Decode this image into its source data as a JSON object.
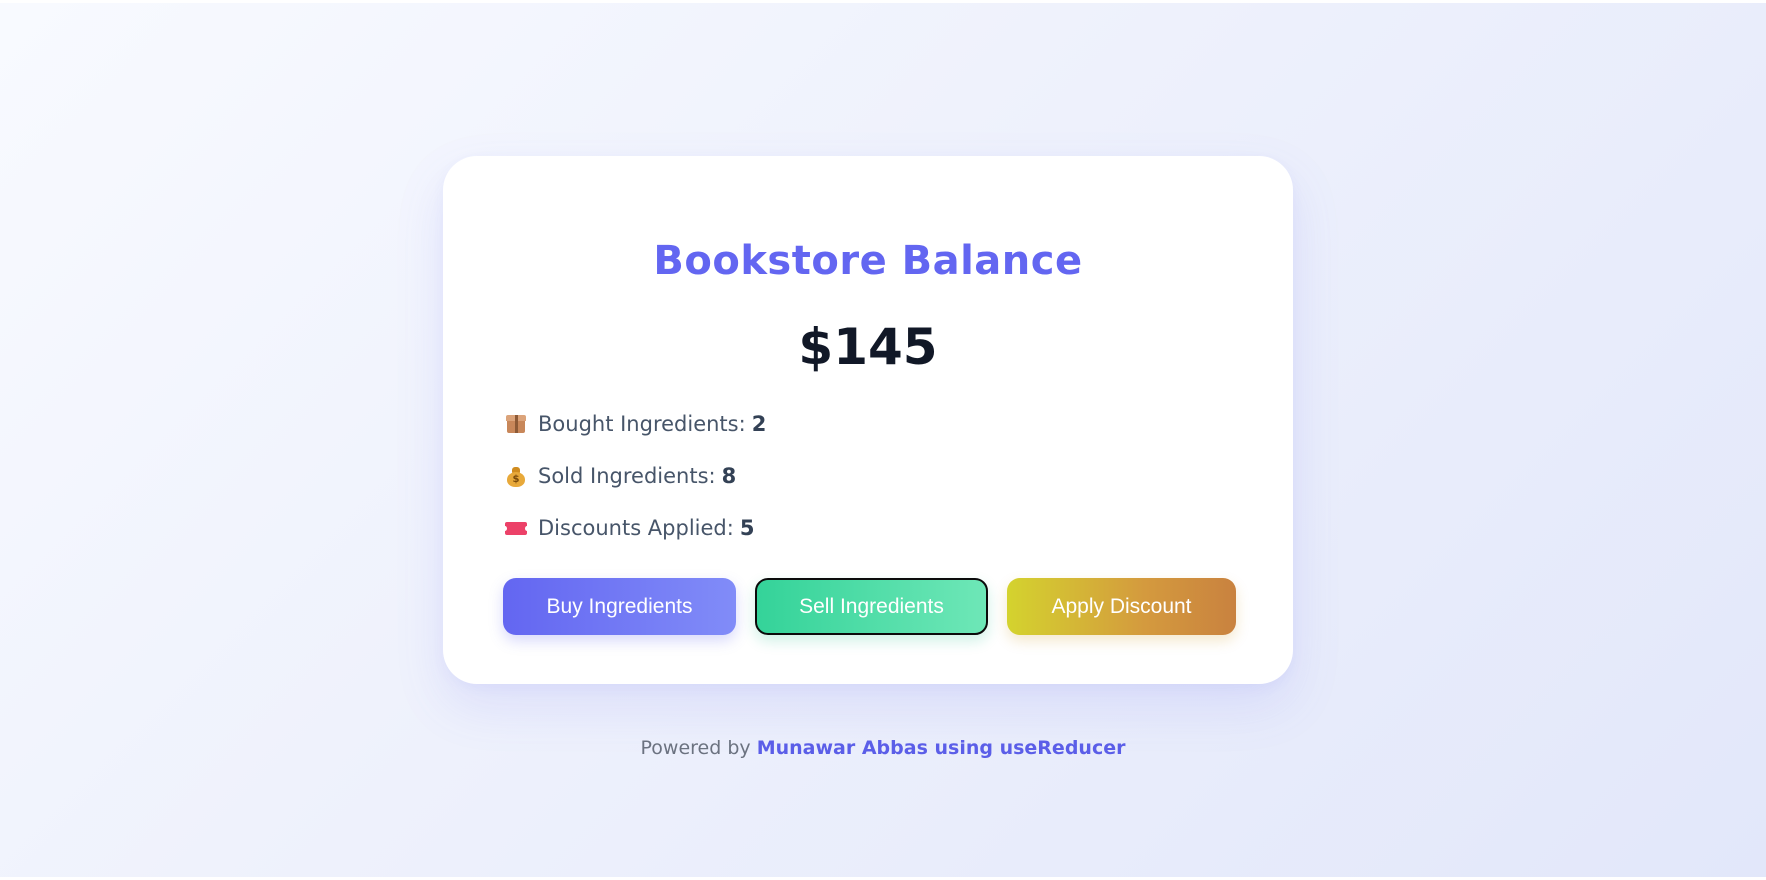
{
  "card": {
    "title": "Bookstore Balance",
    "balance": "$145"
  },
  "stats": [
    {
      "icon": "package-icon",
      "label": "Bought Ingredients:",
      "value": "2"
    },
    {
      "icon": "money-bag-icon",
      "label": "Sold Ingredients:",
      "value": "8"
    },
    {
      "icon": "ticket-icon",
      "label": "Discounts Applied:",
      "value": "5"
    }
  ],
  "buttons": {
    "buy": "Buy Ingredients",
    "sell": "Sell Ingredients",
    "discount": "Apply Discount"
  },
  "footer": {
    "prefix": "Powered by",
    "author": "Munawar Abbas using useReducer"
  },
  "colors": {
    "accent": "#6366f1",
    "buy": "#6366f1",
    "sell": "#34d399",
    "discount": "#d4d32e"
  }
}
